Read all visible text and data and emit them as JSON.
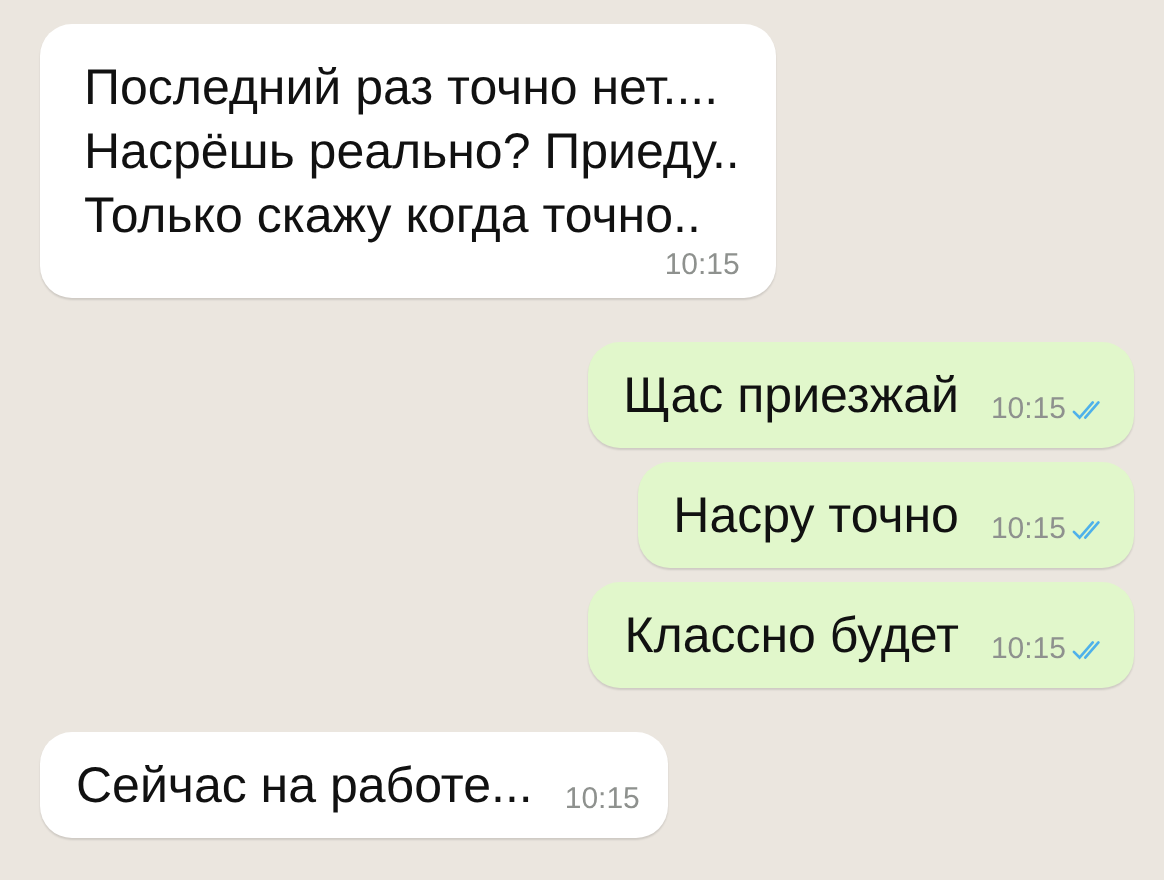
{
  "messages": [
    {
      "kind": "incoming",
      "lines": [
        "Последний раз точно нет....",
        "Насрёшь реально? Приеду..",
        "Только скажу когда точно.."
      ],
      "time": "10:15"
    },
    {
      "kind": "outgoing",
      "lines": [
        "Щас приезжай"
      ],
      "time": "10:15",
      "read": true
    },
    {
      "kind": "outgoing",
      "lines": [
        "Насру точно"
      ],
      "time": "10:15",
      "read": true
    },
    {
      "kind": "outgoing",
      "lines": [
        "Классно будет"
      ],
      "time": "10:15",
      "read": true
    },
    {
      "kind": "incoming",
      "lines": [
        "Сейчас на работе..."
      ],
      "time": "10:15"
    }
  ]
}
